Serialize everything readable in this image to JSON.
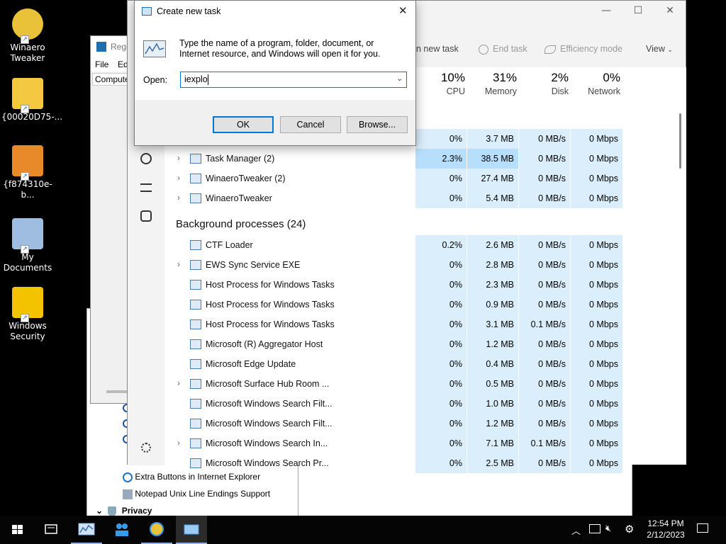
{
  "desktop": {
    "icons": [
      {
        "label": "Winaero Tweaker",
        "icon": "winaero-icon"
      },
      {
        "label": "{00020D75-...",
        "icon": "folder-icon"
      },
      {
        "label": "{f874310e-b...",
        "icon": "home-icon"
      },
      {
        "label": "My Documents",
        "icon": "documents-icon"
      },
      {
        "label": "Windows Security",
        "icon": "lock-icon"
      }
    ]
  },
  "regedit": {
    "title": "Regis",
    "menu": [
      "File",
      "Edi"
    ],
    "address": "Compute",
    "tree": [
      "Extra Buttons in Internet Explorer",
      "Notepad Unix Line Endings Support",
      "Privacy"
    ]
  },
  "taskmanager": {
    "toolbar": {
      "run_new_task": "n new task",
      "end_task": "End task",
      "efficiency_mode": "Efficiency mode",
      "view": "View"
    },
    "columns": [
      {
        "percent": "10%",
        "label": "CPU"
      },
      {
        "percent": "31%",
        "label": "Memory"
      },
      {
        "percent": "2%",
        "label": "Disk"
      },
      {
        "percent": "0%",
        "label": "Network"
      }
    ],
    "apps_rows": [
      {
        "name": "",
        "cpu": "0%",
        "mem": "3.7 MB",
        "disk": "0 MB/s",
        "net": "0 Mbps"
      },
      {
        "name": "Task Manager (2)",
        "cpu": "2.3%",
        "mem": "38.5 MB",
        "disk": "0 MB/s",
        "net": "0 Mbps",
        "expand": true
      },
      {
        "name": "WinaeroTweaker (2)",
        "cpu": "0%",
        "mem": "27.4 MB",
        "disk": "0 MB/s",
        "net": "0 Mbps",
        "expand": true
      },
      {
        "name": "WinaeroTweaker",
        "cpu": "0%",
        "mem": "5.4 MB",
        "disk": "0 MB/s",
        "net": "0 Mbps",
        "expand": true
      }
    ],
    "background_header": "Background processes (24)",
    "bg_rows": [
      {
        "name": "CTF Loader",
        "cpu": "0.2%",
        "mem": "2.6 MB",
        "disk": "0 MB/s",
        "net": "0 Mbps"
      },
      {
        "name": "EWS Sync Service EXE",
        "cpu": "0%",
        "mem": "2.8 MB",
        "disk": "0 MB/s",
        "net": "0 Mbps",
        "expand": true
      },
      {
        "name": "Host Process for Windows Tasks",
        "cpu": "0%",
        "mem": "2.3 MB",
        "disk": "0 MB/s",
        "net": "0 Mbps"
      },
      {
        "name": "Host Process for Windows Tasks",
        "cpu": "0%",
        "mem": "0.9 MB",
        "disk": "0 MB/s",
        "net": "0 Mbps"
      },
      {
        "name": "Host Process for Windows Tasks",
        "cpu": "0%",
        "mem": "3.1 MB",
        "disk": "0.1 MB/s",
        "net": "0 Mbps"
      },
      {
        "name": "Microsoft (R) Aggregator Host",
        "cpu": "0%",
        "mem": "1.2 MB",
        "disk": "0 MB/s",
        "net": "0 Mbps"
      },
      {
        "name": "Microsoft Edge Update",
        "cpu": "0%",
        "mem": "0.4 MB",
        "disk": "0 MB/s",
        "net": "0 Mbps"
      },
      {
        "name": "Microsoft Surface Hub Room ...",
        "cpu": "0%",
        "mem": "0.5 MB",
        "disk": "0 MB/s",
        "net": "0 Mbps",
        "expand": true
      },
      {
        "name": "Microsoft Windows Search Filt...",
        "cpu": "0%",
        "mem": "1.0 MB",
        "disk": "0 MB/s",
        "net": "0 Mbps"
      },
      {
        "name": "Microsoft Windows Search Filt...",
        "cpu": "0%",
        "mem": "1.2 MB",
        "disk": "0 MB/s",
        "net": "0 Mbps"
      },
      {
        "name": "Microsoft Windows Search In...",
        "cpu": "0%",
        "mem": "7.1 MB",
        "disk": "0.1 MB/s",
        "net": "0 Mbps",
        "expand": true
      },
      {
        "name": "Microsoft Windows Search Pr...",
        "cpu": "0%",
        "mem": "2.5 MB",
        "disk": "0 MB/s",
        "net": "0 Mbps"
      }
    ]
  },
  "dialog": {
    "title": "Create new task",
    "description": "Type the name of a program, folder, document, or Internet resource, and Windows will open it for you.",
    "open_label": "Open:",
    "open_value": "iexplo",
    "ok": "OK",
    "cancel": "Cancel",
    "browse": "Browse..."
  },
  "taskbar": {
    "time": "12:54 PM",
    "date": "2/12/2023"
  }
}
